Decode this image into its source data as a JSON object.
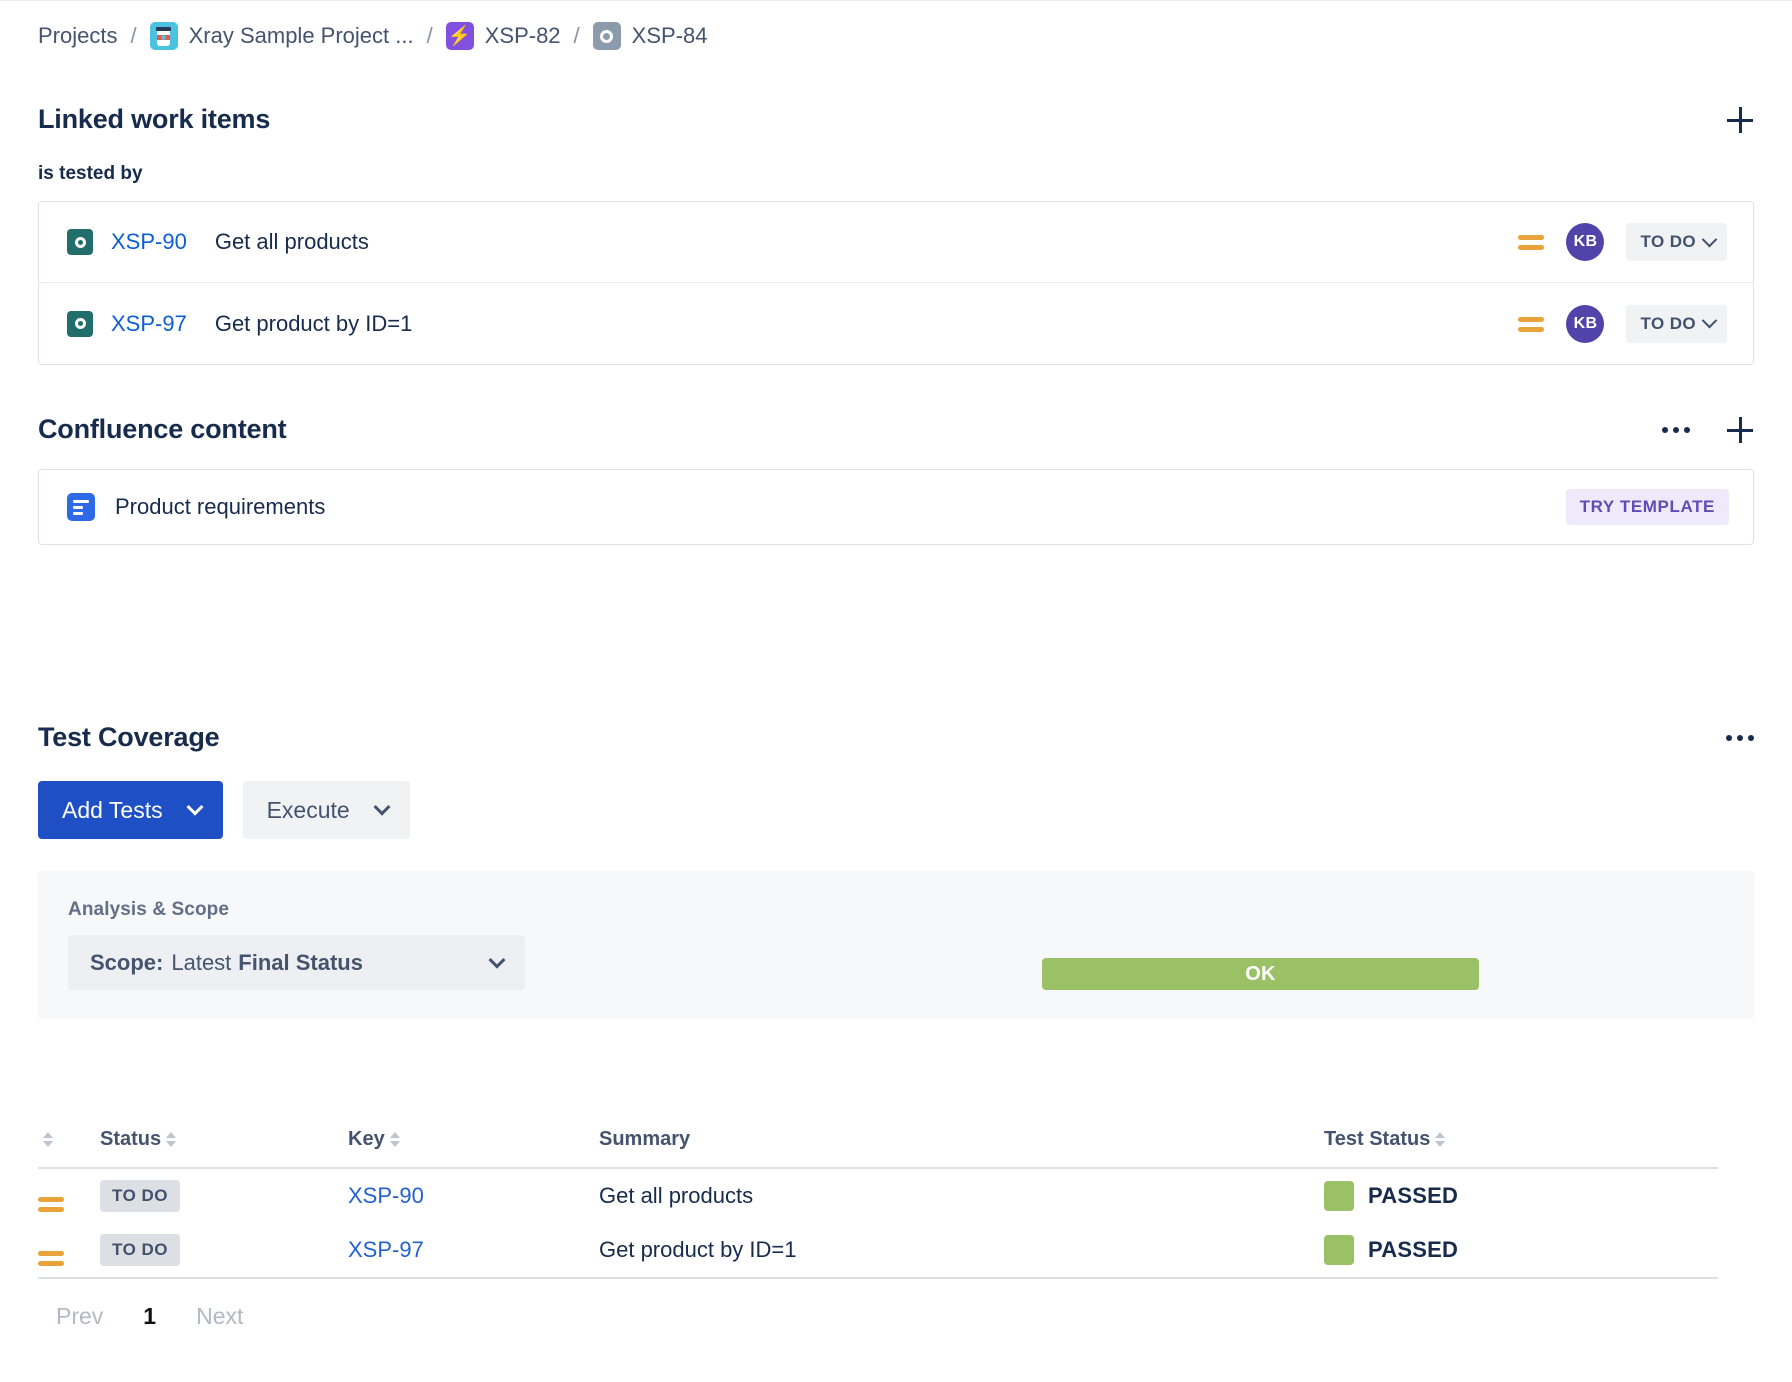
{
  "breadcrumb": {
    "items": [
      {
        "label": "Projects",
        "icon": null
      },
      {
        "label": "Xray Sample Project ...",
        "icon": "coffee-cup-project-icon"
      },
      {
        "label": "XSP-82",
        "icon": "story-bolt-icon"
      },
      {
        "label": "XSP-84",
        "icon": "test-ring-icon"
      }
    ],
    "separator": "/"
  },
  "linked_work_items": {
    "title": "Linked work items",
    "add_icon": "plus-icon",
    "link_type": "is tested by",
    "rows": [
      {
        "type_icon": "test-ring-icon",
        "key": "XSP-90",
        "summary": "Get all products",
        "priority_icon": "priority-medium-icon",
        "assignee_initials": "KB",
        "status": "TO DO"
      },
      {
        "type_icon": "test-ring-icon",
        "key": "XSP-97",
        "summary": "Get product by ID=1",
        "priority_icon": "priority-medium-icon",
        "assignee_initials": "KB",
        "status": "TO DO"
      }
    ]
  },
  "confluence": {
    "title": "Confluence content",
    "more_icon": "more-actions-icon",
    "add_icon": "plus-icon",
    "item": {
      "icon": "confluence-page-icon",
      "name": "Product requirements",
      "badge": "TRY TEMPLATE"
    }
  },
  "test_coverage": {
    "title": "Test Coverage",
    "more_icon": "more-actions-icon",
    "add_tests_label": "Add Tests",
    "execute_label": "Execute",
    "analysis_label": "Analysis & Scope",
    "scope": {
      "prefix": "Scope:",
      "middle": "Latest",
      "suffix": "Final Status"
    },
    "overall_status": "OK",
    "colors": {
      "primary_button": "#1E4FC4",
      "ok_bar": "#9BC167",
      "passed_swatch": "#9BC167",
      "link": "#2362CE",
      "priority_medium": "#E9A33A",
      "avatar": "#5243AA",
      "try_template_text": "#5E4DB2"
    }
  },
  "coverage_table": {
    "columns": [
      "",
      "Status",
      "Key",
      "Summary",
      "Test Status"
    ],
    "rows": [
      {
        "priority": "priority-medium-icon",
        "status": "TO DO",
        "key": "XSP-90",
        "summary": "Get all products",
        "test_status": "PASSED"
      },
      {
        "priority": "priority-medium-icon",
        "status": "TO DO",
        "key": "XSP-97",
        "summary": "Get product by ID=1",
        "test_status": "PASSED"
      }
    ],
    "pagination": {
      "prev": "Prev",
      "current": "1",
      "next": "Next"
    }
  }
}
